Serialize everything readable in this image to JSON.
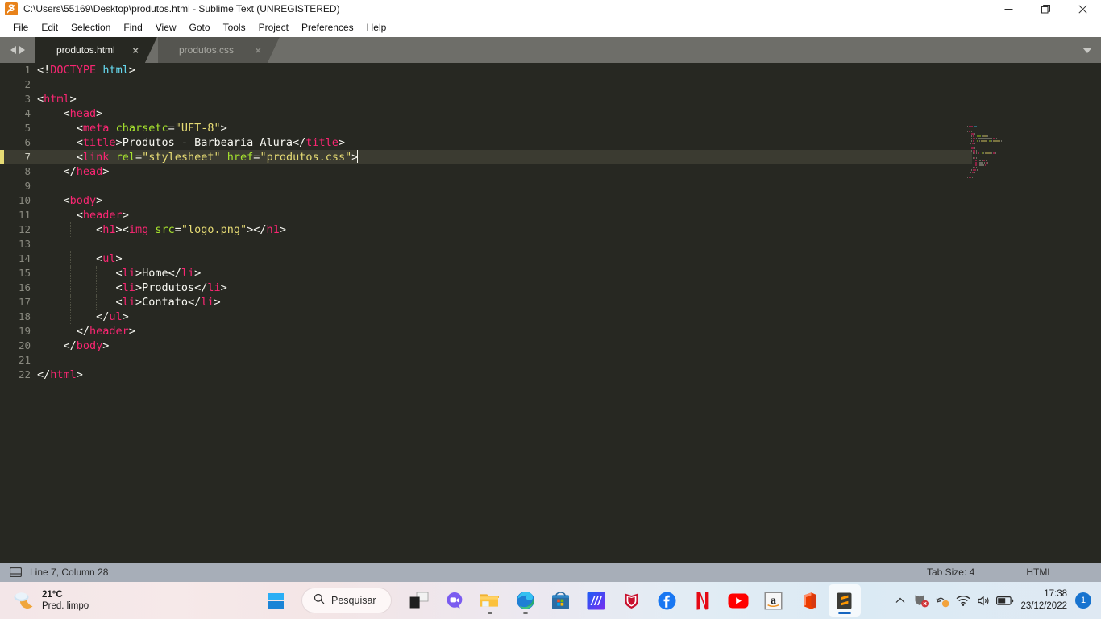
{
  "window": {
    "title": "C:\\Users\\55169\\Desktop\\produtos.html - Sublime Text (UNREGISTERED)",
    "app_icon": "sublime-text-icon",
    "controls": {
      "minimize": "—",
      "maximize": "❐",
      "close": "✕"
    }
  },
  "menubar": {
    "items": [
      {
        "label": "File"
      },
      {
        "label": "Edit"
      },
      {
        "label": "Selection"
      },
      {
        "label": "Find"
      },
      {
        "label": "View"
      },
      {
        "label": "Goto"
      },
      {
        "label": "Tools"
      },
      {
        "label": "Project"
      },
      {
        "label": "Preferences"
      },
      {
        "label": "Help"
      }
    ]
  },
  "tabbar": {
    "nav_prev": "prev-tab-arrow",
    "nav_next": "next-tab-arrow",
    "close_glyph": "×",
    "tabs": [
      {
        "label": "produtos.html",
        "active": true
      },
      {
        "label": "produtos.css",
        "active": false
      }
    ],
    "overflow_menu": "tab-list-dropdown"
  },
  "editor": {
    "current_line": 7,
    "line_numbers": [
      1,
      2,
      3,
      4,
      5,
      6,
      7,
      8,
      9,
      10,
      11,
      12,
      13,
      14,
      15,
      16,
      17,
      18,
      19,
      20,
      21,
      22
    ],
    "lines": [
      {
        "n": 1,
        "tokens": [
          {
            "t": "punc",
            "v": "<!"
          },
          {
            "t": "doct",
            "v": "DOCTYPE"
          },
          {
            "t": "punc",
            "v": " "
          },
          {
            "t": "doctval",
            "v": "html"
          },
          {
            "t": "punc",
            "v": ">"
          }
        ]
      },
      {
        "n": 2,
        "tokens": []
      },
      {
        "n": 3,
        "tokens": [
          {
            "t": "punc",
            "v": "<"
          },
          {
            "t": "tag",
            "v": "html"
          },
          {
            "t": "punc",
            "v": ">"
          }
        ]
      },
      {
        "n": 4,
        "tokens": [
          {
            "t": "punc",
            "v": "    <"
          },
          {
            "t": "tag",
            "v": "head"
          },
          {
            "t": "punc",
            "v": ">"
          }
        ]
      },
      {
        "n": 5,
        "tokens": [
          {
            "t": "punc",
            "v": "      <"
          },
          {
            "t": "tag",
            "v": "meta"
          },
          {
            "t": "punc",
            "v": " "
          },
          {
            "t": "attr",
            "v": "charsetc"
          },
          {
            "t": "punc",
            "v": "="
          },
          {
            "t": "str",
            "v": "\"UFT-8\""
          },
          {
            "t": "punc",
            "v": ">"
          }
        ]
      },
      {
        "n": 6,
        "tokens": [
          {
            "t": "punc",
            "v": "      <"
          },
          {
            "t": "tag",
            "v": "title"
          },
          {
            "t": "punc",
            "v": ">"
          },
          {
            "t": "txt",
            "v": "Produtos - Barbearia Alura"
          },
          {
            "t": "punc",
            "v": "</"
          },
          {
            "t": "tag",
            "v": "title"
          },
          {
            "t": "punc",
            "v": ">"
          }
        ]
      },
      {
        "n": 7,
        "tokens": [
          {
            "t": "punc",
            "v": "      <"
          },
          {
            "t": "tag",
            "v": "link"
          },
          {
            "t": "punc",
            "v": " "
          },
          {
            "t": "attr",
            "v": "rel"
          },
          {
            "t": "punc",
            "v": "="
          },
          {
            "t": "str",
            "v": "\"stylesheet\""
          },
          {
            "t": "punc",
            "v": " "
          },
          {
            "t": "attr",
            "v": "href"
          },
          {
            "t": "punc",
            "v": "="
          },
          {
            "t": "str",
            "v": "\"produtos.css\""
          },
          {
            "t": "punc",
            "v": ">"
          }
        ]
      },
      {
        "n": 8,
        "tokens": [
          {
            "t": "punc",
            "v": "    </"
          },
          {
            "t": "tag",
            "v": "head"
          },
          {
            "t": "punc",
            "v": ">"
          }
        ]
      },
      {
        "n": 9,
        "tokens": []
      },
      {
        "n": 10,
        "tokens": [
          {
            "t": "punc",
            "v": "    <"
          },
          {
            "t": "tag",
            "v": "body"
          },
          {
            "t": "punc",
            "v": ">"
          }
        ]
      },
      {
        "n": 11,
        "tokens": [
          {
            "t": "punc",
            "v": "      <"
          },
          {
            "t": "tag",
            "v": "header"
          },
          {
            "t": "punc",
            "v": ">"
          }
        ]
      },
      {
        "n": 12,
        "tokens": [
          {
            "t": "punc",
            "v": "         <"
          },
          {
            "t": "tag",
            "v": "h1"
          },
          {
            "t": "punc",
            "v": "><"
          },
          {
            "t": "tag",
            "v": "img"
          },
          {
            "t": "punc",
            "v": " "
          },
          {
            "t": "attr",
            "v": "src"
          },
          {
            "t": "punc",
            "v": "="
          },
          {
            "t": "str",
            "v": "\"logo.png\""
          },
          {
            "t": "punc",
            "v": "></"
          },
          {
            "t": "tag",
            "v": "h1"
          },
          {
            "t": "punc",
            "v": ">"
          }
        ]
      },
      {
        "n": 13,
        "tokens": []
      },
      {
        "n": 14,
        "tokens": [
          {
            "t": "punc",
            "v": "         <"
          },
          {
            "t": "tag",
            "v": "ul"
          },
          {
            "t": "punc",
            "v": ">"
          }
        ]
      },
      {
        "n": 15,
        "tokens": [
          {
            "t": "punc",
            "v": "            <"
          },
          {
            "t": "tag",
            "v": "li"
          },
          {
            "t": "punc",
            "v": ">"
          },
          {
            "t": "txt",
            "v": "Home"
          },
          {
            "t": "punc",
            "v": "</"
          },
          {
            "t": "tag",
            "v": "li"
          },
          {
            "t": "punc",
            "v": ">"
          }
        ]
      },
      {
        "n": 16,
        "tokens": [
          {
            "t": "punc",
            "v": "            <"
          },
          {
            "t": "tag",
            "v": "li"
          },
          {
            "t": "punc",
            "v": ">"
          },
          {
            "t": "txt",
            "v": "Produtos"
          },
          {
            "t": "punc",
            "v": "</"
          },
          {
            "t": "tag",
            "v": "li"
          },
          {
            "t": "punc",
            "v": ">"
          }
        ]
      },
      {
        "n": 17,
        "tokens": [
          {
            "t": "punc",
            "v": "            <"
          },
          {
            "t": "tag",
            "v": "li"
          },
          {
            "t": "punc",
            "v": ">"
          },
          {
            "t": "txt",
            "v": "Contato"
          },
          {
            "t": "punc",
            "v": "</"
          },
          {
            "t": "tag",
            "v": "li"
          },
          {
            "t": "punc",
            "v": ">"
          }
        ]
      },
      {
        "n": 18,
        "tokens": [
          {
            "t": "punc",
            "v": "         </"
          },
          {
            "t": "tag",
            "v": "ul"
          },
          {
            "t": "punc",
            "v": ">"
          }
        ]
      },
      {
        "n": 19,
        "tokens": [
          {
            "t": "punc",
            "v": "      </"
          },
          {
            "t": "tag",
            "v": "header"
          },
          {
            "t": "punc",
            "v": ">"
          }
        ]
      },
      {
        "n": 20,
        "tokens": [
          {
            "t": "punc",
            "v": "    </"
          },
          {
            "t": "tag",
            "v": "body"
          },
          {
            "t": "punc",
            "v": ">"
          }
        ]
      },
      {
        "n": 21,
        "tokens": []
      },
      {
        "n": 22,
        "tokens": [
          {
            "t": "punc",
            "v": "</"
          },
          {
            "t": "tag",
            "v": "html"
          },
          {
            "t": "punc",
            "v": ">"
          }
        ]
      }
    ],
    "colors": {
      "background": "#272822",
      "current_line": "#3b3b31",
      "tag": "#f92672",
      "attribute": "#a6e22e",
      "string": "#e6db74",
      "text": "#f8f8f2",
      "gutter_text": "#8a8a80",
      "caret": "#e6db74"
    }
  },
  "statusbar": {
    "layout_icon": "layout-icon",
    "position": "Line 7, Column 28",
    "tab_size": "Tab Size: 4",
    "syntax": "HTML"
  },
  "taskbar": {
    "weather": {
      "temperature": "21°C",
      "condition": "Pred. limpo",
      "icon": "partly-cloudy-night-icon"
    },
    "start_button": "windows-start-icon",
    "search": {
      "label": "Pesquisar",
      "icon": "search-icon"
    },
    "apps": [
      {
        "name": "task-view-icon",
        "label": "Task View",
        "active": false,
        "running": false
      },
      {
        "name": "chat-teams-icon",
        "label": "Chat",
        "active": false,
        "running": false
      },
      {
        "name": "file-explorer-icon",
        "label": "File Explorer",
        "active": false,
        "running": true
      },
      {
        "name": "microsoft-edge-icon",
        "label": "Microsoft Edge",
        "active": false,
        "running": true
      },
      {
        "name": "microsoft-store-icon",
        "label": "Microsoft Store",
        "active": false,
        "running": false
      },
      {
        "name": "alura-icon",
        "label": "Alura",
        "active": false,
        "running": false
      },
      {
        "name": "mcafee-icon",
        "label": "McAfee",
        "active": false,
        "running": false
      },
      {
        "name": "facebook-icon",
        "label": "Facebook",
        "active": false,
        "running": false
      },
      {
        "name": "netflix-icon",
        "label": "Netflix",
        "active": false,
        "running": false
      },
      {
        "name": "youtube-icon",
        "label": "YouTube",
        "active": false,
        "running": false
      },
      {
        "name": "amazon-icon",
        "label": "Amazon",
        "active": false,
        "running": false
      },
      {
        "name": "microsoft-office-icon",
        "label": "Office",
        "active": false,
        "running": false
      },
      {
        "name": "sublime-text-icon",
        "label": "Sublime Text",
        "active": true,
        "running": true
      }
    ],
    "tray": {
      "chevron": "show-hidden-icons-chevron",
      "icons": [
        "mcafee-alert-icon",
        "onedrive-sync-icon",
        "wifi-icon",
        "volume-icon",
        "battery-icon"
      ],
      "time": "17:38",
      "date": "23/12/2022",
      "notifications_count": "1"
    }
  }
}
